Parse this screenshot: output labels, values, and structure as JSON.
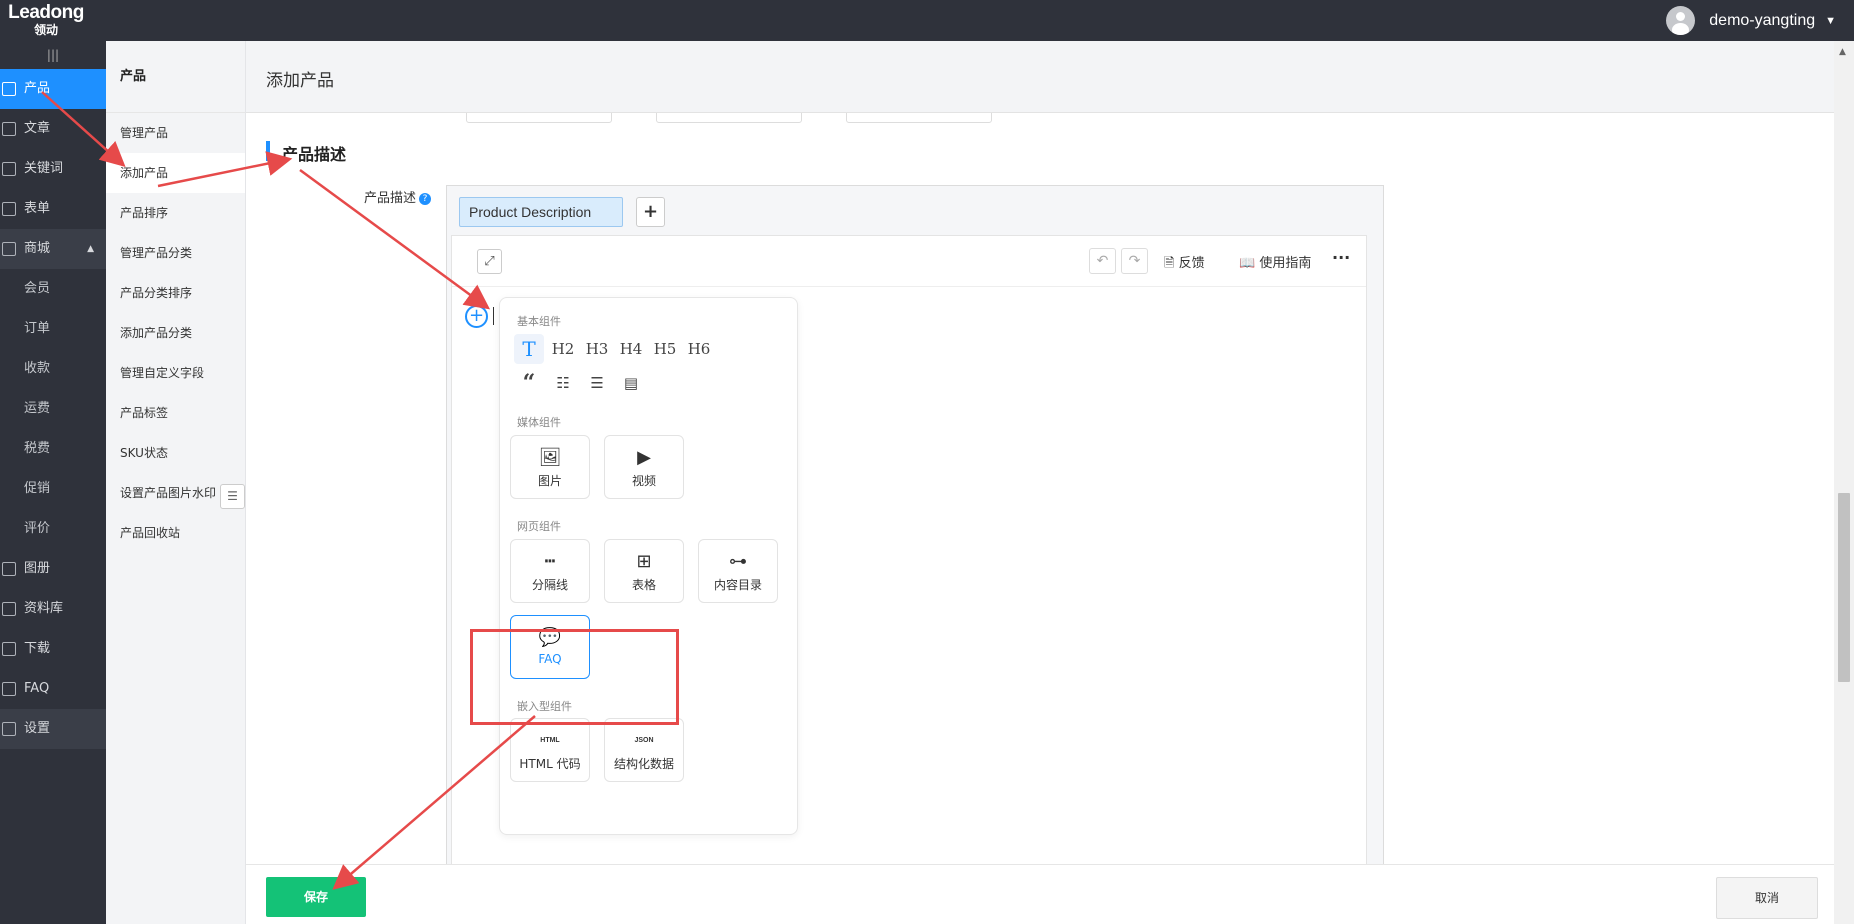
{
  "brand": {
    "logo_en": "Leadong",
    "logo_cn": "领动"
  },
  "user": {
    "name": "demo-yangting"
  },
  "leftnav": {
    "items": [
      {
        "label": "产品",
        "icon": "grid-icon",
        "active": true
      },
      {
        "label": "文章",
        "icon": "article-icon"
      },
      {
        "label": "关键词",
        "icon": "keyword-icon"
      },
      {
        "label": "表单",
        "icon": "form-icon"
      },
      {
        "label": "商城",
        "icon": "shop-icon"
      },
      {
        "label": "会员"
      },
      {
        "label": "订单"
      },
      {
        "label": "收款"
      },
      {
        "label": "运费"
      },
      {
        "label": "税费"
      },
      {
        "label": "促销"
      },
      {
        "label": "评价"
      },
      {
        "label": "图册",
        "icon": "album-icon"
      },
      {
        "label": "资料库",
        "icon": "library-icon"
      },
      {
        "label": "下载",
        "icon": "download-icon"
      },
      {
        "label": "FAQ",
        "icon": "faq-icon"
      },
      {
        "label": "设置",
        "icon": "gear-icon"
      }
    ]
  },
  "subnav": {
    "title": "产品",
    "items": [
      {
        "label": "管理产品"
      },
      {
        "label": "添加产品",
        "selected": true
      },
      {
        "label": "产品排序"
      },
      {
        "label": "管理产品分类"
      },
      {
        "label": "产品分类排序"
      },
      {
        "label": "添加产品分类"
      },
      {
        "label": "管理自定义字段"
      },
      {
        "label": "产品标签"
      },
      {
        "label": "SKU状态"
      },
      {
        "label": "设置产品图片水印"
      },
      {
        "label": "产品回收站"
      }
    ]
  },
  "page": {
    "title": "添加产品"
  },
  "section": {
    "title": "产品描述",
    "field_label": "产品描述",
    "help": "?"
  },
  "editor": {
    "tab_label": "Product Description",
    "add_tab": "+",
    "toolbar": {
      "feedback": "反馈",
      "guide": "使用指南",
      "more": "···"
    }
  },
  "picker": {
    "basic_title": "基本组件",
    "basic": [
      "T",
      "H2",
      "H3",
      "H4",
      "H5",
      "H6"
    ],
    "basic_row2": [
      "quote",
      "bullet-list",
      "numbered-list",
      "callout"
    ],
    "media_title": "媒体组件",
    "media": [
      {
        "label": "图片"
      },
      {
        "label": "视频"
      }
    ],
    "web_title": "网页组件",
    "web": [
      {
        "label": "分隔线"
      },
      {
        "label": "表格"
      },
      {
        "label": "内容目录"
      },
      {
        "label": "FAQ"
      }
    ],
    "embed_title": "嵌入型组件",
    "embed": [
      {
        "label": "HTML 代码",
        "badge": "HTML"
      },
      {
        "label": "结构化数据",
        "badge": "JSON"
      }
    ]
  },
  "footer": {
    "save": "保存",
    "cancel": "取消"
  },
  "colors": {
    "accent": "#1e90ff",
    "save": "#14c277",
    "annotation": "#e64a4a",
    "nav_bg": "#2f323b"
  }
}
